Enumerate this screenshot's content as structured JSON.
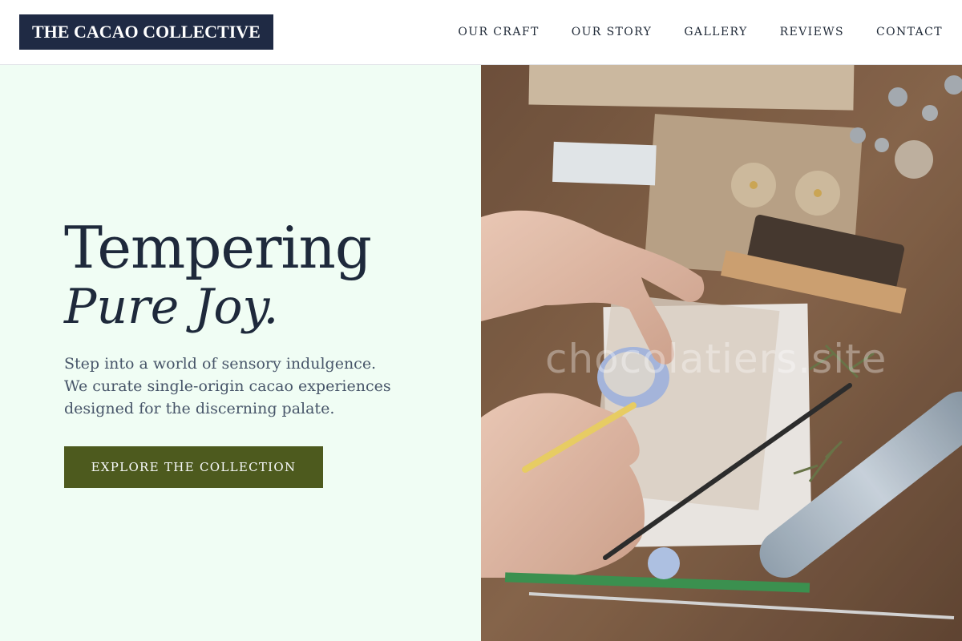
{
  "brand": {
    "name": "THE CACAO COLLECTIVE"
  },
  "nav": {
    "items": [
      {
        "label": "OUR CRAFT"
      },
      {
        "label": "OUR STORY"
      },
      {
        "label": "GALLERY"
      },
      {
        "label": "REVIEWS"
      },
      {
        "label": "CONTACT"
      }
    ]
  },
  "hero": {
    "headline_line1": "Tempering",
    "headline_line2": "Pure Joy.",
    "description_line1": "Step into a world of sensory indulgence.",
    "description_line2": "We curate single-origin cacao experiences",
    "description_line3": "designed for the discerning palate.",
    "cta_label": "EXPLORE THE COLLECTION",
    "image_watermark": "chocolatiers.site"
  },
  "colors": {
    "logo_bg": "#1f2a44",
    "hero_bg": "#f0fdf4",
    "cta_bg": "#4d5a1e",
    "headline": "#1e293b"
  }
}
